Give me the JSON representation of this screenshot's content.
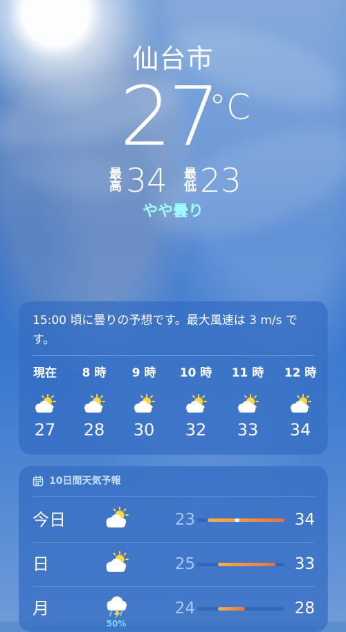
{
  "header": {
    "city": "仙台市",
    "temperature": "27",
    "unit": "°C",
    "high_label_top": "最",
    "high_label_bottom": "高",
    "high_value": "34",
    "low_label_top": "最",
    "low_label_bottom": "低",
    "low_value": "23",
    "condition": "やや曇り"
  },
  "hourly_forecast": {
    "summary": "15:00 頃に曇りの予想です。最大風速は 3 m/s です。",
    "hours": [
      {
        "time": "現在",
        "icon": "partly-cloudy-sun-icon",
        "temp": "27"
      },
      {
        "time": "8 時",
        "icon": "partly-cloudy-sun-icon",
        "temp": "28"
      },
      {
        "time": "9 時",
        "icon": "partly-cloudy-sun-icon",
        "temp": "30"
      },
      {
        "time": "10 時",
        "icon": "partly-cloudy-sun-icon",
        "temp": "32"
      },
      {
        "time": "11 時",
        "icon": "partly-cloudy-sun-icon",
        "temp": "33"
      },
      {
        "time": "12 時",
        "icon": "partly-cloudy-sun-icon",
        "temp": "34"
      }
    ]
  },
  "daily_forecast": {
    "title": "10日間天気予報",
    "icon": "calendar-icon",
    "days": [
      {
        "day": "今日",
        "icon": "partly-cloudy-sun-icon",
        "low": "23",
        "high": "34",
        "range_start": 0.12,
        "range_end": 1.0,
        "current_marker": 0.46
      },
      {
        "day": "日",
        "icon": "partly-cloudy-sun-icon",
        "low": "25",
        "high": "33",
        "range_start": 0.24,
        "range_end": 0.9
      },
      {
        "day": "月",
        "icon": "thunder-rain-icon",
        "rain_chance": "50%",
        "low": "24",
        "high": "28",
        "range_start": 0.24,
        "range_end": 0.55
      }
    ]
  },
  "colors": {
    "condition_text": "#9dffff",
    "rain_chance": "#7ad4ff",
    "range_gradient_start": "#f2b24a",
    "range_gradient_end": "#ea6f45"
  }
}
